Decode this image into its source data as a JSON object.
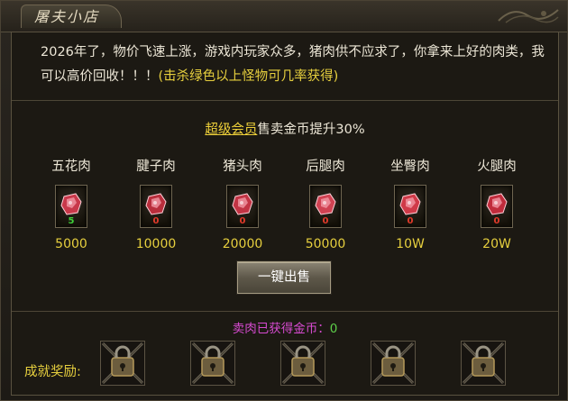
{
  "window": {
    "title": "屠夫小店"
  },
  "intro": {
    "text": "2026年了，物价飞速上涨，游戏内玩家众多，猪肉供不应求了，你拿来上好的肉类，我可以高价回收！！！",
    "highlight": "(击杀绿色以上怪物可几率获得)"
  },
  "vip": {
    "link": "超级会员",
    "text": "售卖金币提升30%"
  },
  "items": [
    {
      "name": "五花肉",
      "count": "5",
      "price": "5000",
      "count_color": "#3fd23a"
    },
    {
      "name": "腱子肉",
      "count": "0",
      "price": "10000",
      "count_color": "#e23a2a"
    },
    {
      "name": "猪头肉",
      "count": "0",
      "price": "20000",
      "count_color": "#e23a2a"
    },
    {
      "name": "后腿肉",
      "count": "0",
      "price": "50000",
      "count_color": "#e23a2a"
    },
    {
      "name": "坐臀肉",
      "count": "0",
      "price": "10W",
      "count_color": "#e23a2a"
    },
    {
      "name": "火腿肉",
      "count": "0",
      "price": "20W",
      "count_color": "#e23a2a"
    }
  ],
  "sell_button": "一键出售",
  "earned": {
    "label": "卖肉已获得金币：",
    "value": "0"
  },
  "rewards": {
    "label": "成就奖励:"
  }
}
